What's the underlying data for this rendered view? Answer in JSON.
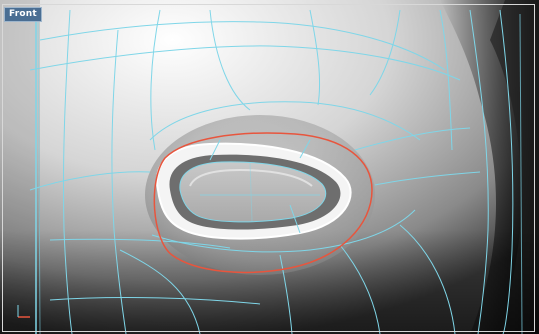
{
  "viewport": {
    "label": "Front",
    "label_color": "#4a6e93",
    "wire_color": "#7fd6e8",
    "selection_color": "#e8553d"
  }
}
